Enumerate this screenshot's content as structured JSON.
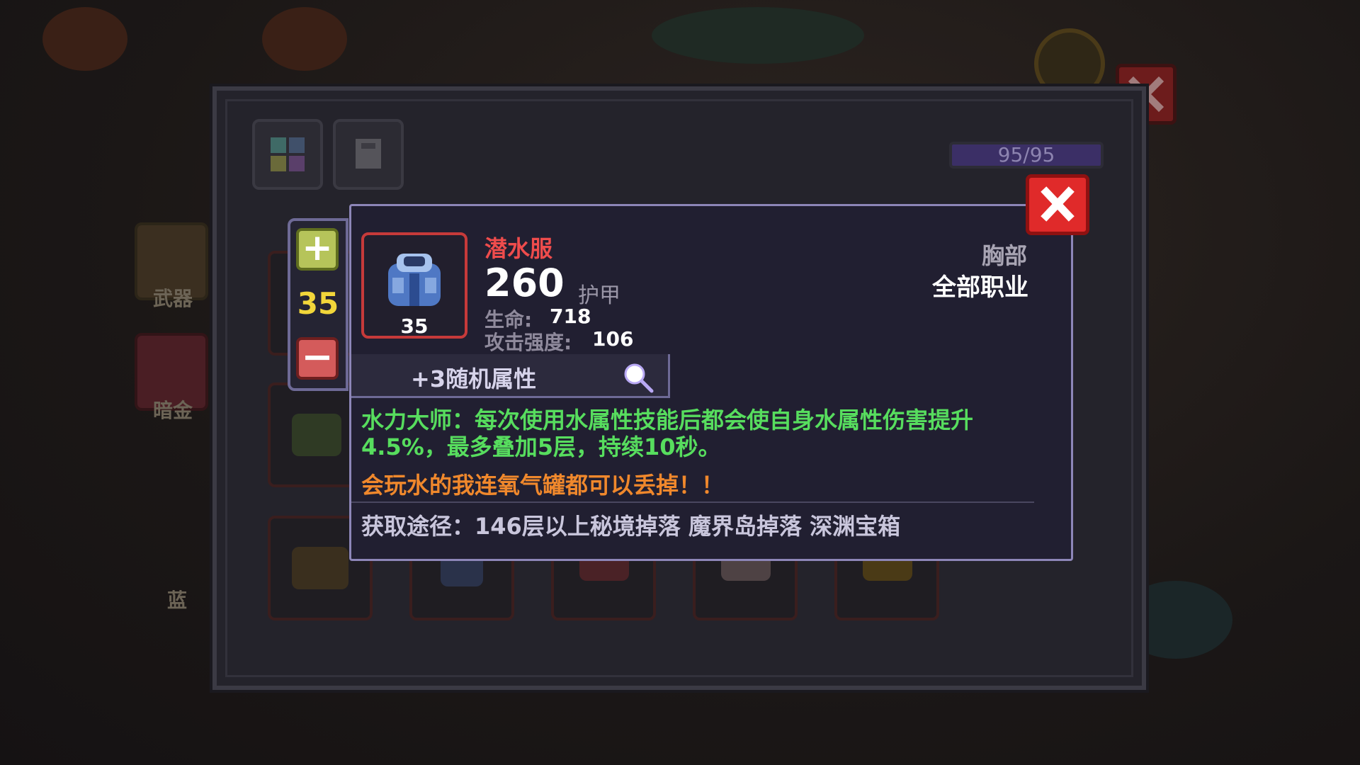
{
  "storage": {
    "capacity": "95/95"
  },
  "categories": [
    {
      "label": "武器"
    },
    {
      "label": "暗金"
    },
    {
      "label": "蓝"
    }
  ],
  "stepper": {
    "plus": "+",
    "level": "35",
    "minus": "−"
  },
  "item": {
    "name": "潜水服",
    "level": "35",
    "armor_value": "260",
    "armor_label": "护甲",
    "stats": [
      {
        "label": "生命:",
        "value": "718"
      },
      {
        "label": "攻击强度:",
        "value": "106"
      }
    ],
    "slot_type": "胸部",
    "class_requirement": "全部职业",
    "random_attributes": "+3随机属性",
    "skill_line1": "水力大师：每次使用水属性技能后都会使自身水属性伤害提升",
    "skill_line2": "4.5%，最多叠加5层，持续10秒。",
    "flavor": "会玩水的我连氧气罐都可以丢掉！！",
    "source": "获取途径：146层以上秘境掉落 魔界岛掉落 深渊宝箱"
  },
  "colors": {
    "item_name": "#ef4c4c",
    "skill": "#57dd5e",
    "flavor": "#f0882c",
    "level": "#f2d63a",
    "close": "#e02a2a"
  }
}
